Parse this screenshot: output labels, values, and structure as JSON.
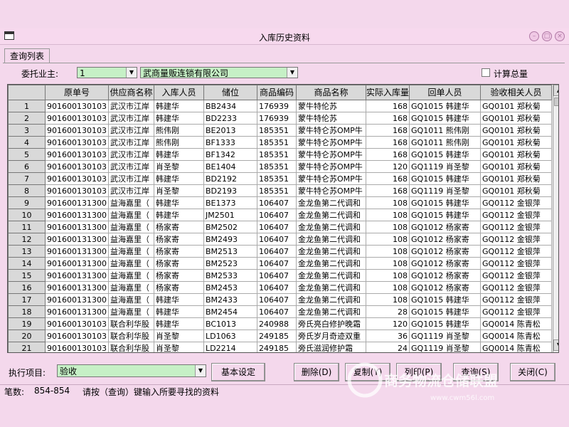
{
  "window": {
    "title": "入库历史资料"
  },
  "tab": {
    "label": "查询列表"
  },
  "filters": {
    "consignor_label": "委托业主:",
    "consignor_id": "1",
    "consignor_name": "武商量贩连锁有限公司",
    "total_checkbox_label": "计算总量"
  },
  "grid": {
    "columns": [
      "原单号",
      "供应商名称",
      "入库人员",
      "储位",
      "商品编码",
      "商品名称",
      "实际入库量",
      "回单人员",
      "验收相关人员"
    ],
    "rows": [
      [
        "1",
        "901600130103",
        "武汉市江岸",
        "韩建华",
        "BB2434",
        "176939",
        "蒙牛特伦苏",
        "168",
        "GQ1015 韩建华",
        "GQ0101 郑秋菊"
      ],
      [
        "2",
        "901600130103",
        "武汉市江岸",
        "韩建华",
        "BD2233",
        "176939",
        "蒙牛特伦苏",
        "168",
        "GQ1015 韩建华",
        "GQ0101 郑秋菊"
      ],
      [
        "3",
        "901600130103",
        "武汉市江岸",
        "熊伟刚",
        "BE2013",
        "185351",
        "蒙牛特仑苏OMP牛",
        "168",
        "GQ1011 熊伟刚",
        "GQ0101 郑秋菊"
      ],
      [
        "4",
        "901600130103",
        "武汉市江岸",
        "熊伟刚",
        "BF1333",
        "185351",
        "蒙牛特仑苏OMP牛",
        "168",
        "GQ1011 熊伟刚",
        "GQ0101 郑秋菊"
      ],
      [
        "5",
        "901600130103",
        "武汉市江岸",
        "韩建华",
        "BF1342",
        "185351",
        "蒙牛特仑苏OMP牛",
        "168",
        "GQ1015 韩建华",
        "GQ0101 郑秋菊"
      ],
      [
        "6",
        "901600130103",
        "武汉市江岸",
        "肖圣黎",
        "BE1404",
        "185351",
        "蒙牛特仑苏OMP牛",
        "120",
        "GQ1119 肖圣黎",
        "GQ0101 郑秋菊"
      ],
      [
        "7",
        "901600130103",
        "武汉市江岸",
        "韩建华",
        "BD2192",
        "185351",
        "蒙牛特仑苏OMP牛",
        "168",
        "GQ1015 韩建华",
        "GQ0101 郑秋菊"
      ],
      [
        "8",
        "901600130103",
        "武汉市江岸",
        "肖圣黎",
        "BD2193",
        "185351",
        "蒙牛特仑苏OMP牛",
        "168",
        "GQ1119 肖圣黎",
        "GQ0101 郑秋菊"
      ],
      [
        "9",
        "901600131300",
        "益海嘉里（",
        "韩建华",
        "BE1373",
        "106407",
        "金龙鱼第二代调和",
        "108",
        "GQ1015 韩建华",
        "GQ0112 金银萍"
      ],
      [
        "10",
        "901600131300",
        "益海嘉里（",
        "韩建华",
        "JM2501",
        "106407",
        "金龙鱼第二代调和",
        "108",
        "GQ1015 韩建华",
        "GQ0112 金银萍"
      ],
      [
        "11",
        "901600131300",
        "益海嘉里（",
        "杨家寄",
        "BM2502",
        "106407",
        "金龙鱼第二代调和",
        "108",
        "GQ1012 杨家寄",
        "GQ0112 金银萍"
      ],
      [
        "12",
        "901600131300",
        "益海嘉里（",
        "杨家寄",
        "BM2493",
        "106407",
        "金龙鱼第二代调和",
        "108",
        "GQ1012 杨家寄",
        "GQ0112 金银萍"
      ],
      [
        "13",
        "901600131300",
        "益海嘉里（",
        "杨家寄",
        "BM2513",
        "106407",
        "金龙鱼第二代调和",
        "108",
        "GQ1012 杨家寄",
        "GQ0112 金银萍"
      ],
      [
        "14",
        "901600131300",
        "益海嘉里（",
        "杨家寄",
        "BM2523",
        "106407",
        "金龙鱼第二代调和",
        "108",
        "GQ1012 杨家寄",
        "GQ0112 金银萍"
      ],
      [
        "15",
        "901600131300",
        "益海嘉里（",
        "杨家寄",
        "BM2533",
        "106407",
        "金龙鱼第二代调和",
        "108",
        "GQ1012 杨家寄",
        "GQ0112 金银萍"
      ],
      [
        "16",
        "901600131300",
        "益海嘉里（",
        "杨家寄",
        "BM2453",
        "106407",
        "金龙鱼第二代调和",
        "108",
        "GQ1012 杨家寄",
        "GQ0112 金银萍"
      ],
      [
        "17",
        "901600131300",
        "益海嘉里（",
        "韩建华",
        "BM2433",
        "106407",
        "金龙鱼第二代调和",
        "108",
        "GQ1015 韩建华",
        "GQ0112 金银萍"
      ],
      [
        "18",
        "901600131300",
        "益海嘉里（",
        "韩建华",
        "BM2454",
        "106407",
        "金龙鱼第二代调和",
        "28",
        "GQ1015 韩建华",
        "GQ0112 金银萍"
      ],
      [
        "19",
        "901600130103",
        "联合利华股",
        "韩建华",
        "BC1013",
        "240988",
        "旁氏亮白修护晚霜",
        "120",
        "GQ1015 韩建华",
        "GQ0014 陈青松"
      ],
      [
        "20",
        "901600130103",
        "联合利华股",
        "肖圣黎",
        "LD1063",
        "249185",
        "旁氏岁月奇迹双重",
        "36",
        "GQ1119 肖圣黎",
        "GQ0014 陈青松"
      ],
      [
        "21",
        "901600130103",
        "联合利华股",
        "肖圣黎",
        "LD2214",
        "249185",
        "旁氏滋润修护霜",
        "24",
        "GQ1119 肖圣黎",
        "GQ0014 陈青松"
      ]
    ]
  },
  "actions": {
    "execute_label": "执行项目:",
    "execute_value": "验收",
    "basic_settings": "基本设定",
    "delete": "删除(D)",
    "copy": "复制(Y)",
    "print": "列印(P)",
    "query": "查询(S)",
    "close": "关闭(C)"
  },
  "status": {
    "count_label": "笔数:",
    "count_value": "854-854",
    "hint": "请按（查询）键输入所要寻找的资料"
  },
  "watermark": {
    "brand": "商务物流仓储联盟",
    "url": "www.cwm56l.com"
  }
}
